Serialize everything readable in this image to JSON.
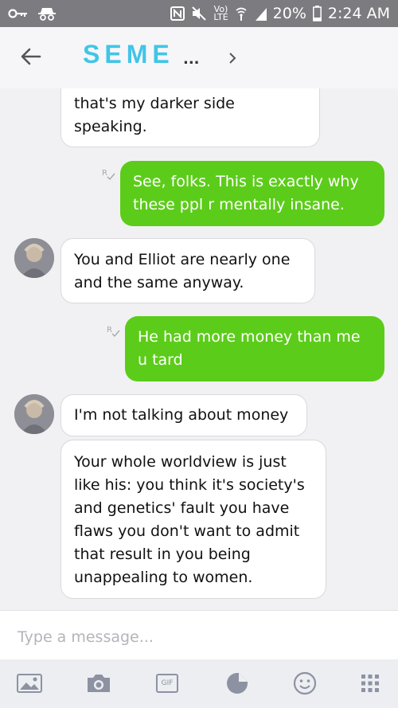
{
  "status_bar": {
    "network_line1": "Vo)",
    "network_line2": "LTE",
    "battery": "20%",
    "time": "2:24 AM"
  },
  "header": {
    "title": "SEME",
    "ellipsis": "..."
  },
  "messages": [
    {
      "side": "received",
      "lines": [
        "that's my darker side",
        "speaking."
      ]
    },
    {
      "side": "sent",
      "lines": [
        "See, folks. This is exactly why",
        "these ppl r mentally insane."
      ]
    },
    {
      "side": "received",
      "lines": [
        "You and Elliot are nearly one",
        "and the same anyway."
      ]
    },
    {
      "side": "sent",
      "lines": [
        "He had more money than me",
        "u tard"
      ]
    },
    {
      "side": "received",
      "lines": [
        "I'm not talking about money"
      ]
    },
    {
      "side": "received",
      "lines": [
        "Your whole worldview is just",
        "like his: you think it's society's",
        "and genetics' fault you have",
        "flaws you don't want to admit",
        "that result in you being",
        "unappealing to women."
      ]
    }
  ],
  "compose": {
    "placeholder": "Type a message..."
  },
  "toolbar": {
    "gif_label": "GIF",
    "icons": [
      "image-icon",
      "camera-icon",
      "gif-icon",
      "sticker-icon",
      "emoji-icon",
      "apps-grid-icon"
    ]
  },
  "colors": {
    "status_bar": "#7c7c80",
    "brand": "#41c5e7",
    "sent_bubble": "#5ccc1a",
    "received_bubble": "#ffffff",
    "icon_grey": "#8d92a3"
  }
}
